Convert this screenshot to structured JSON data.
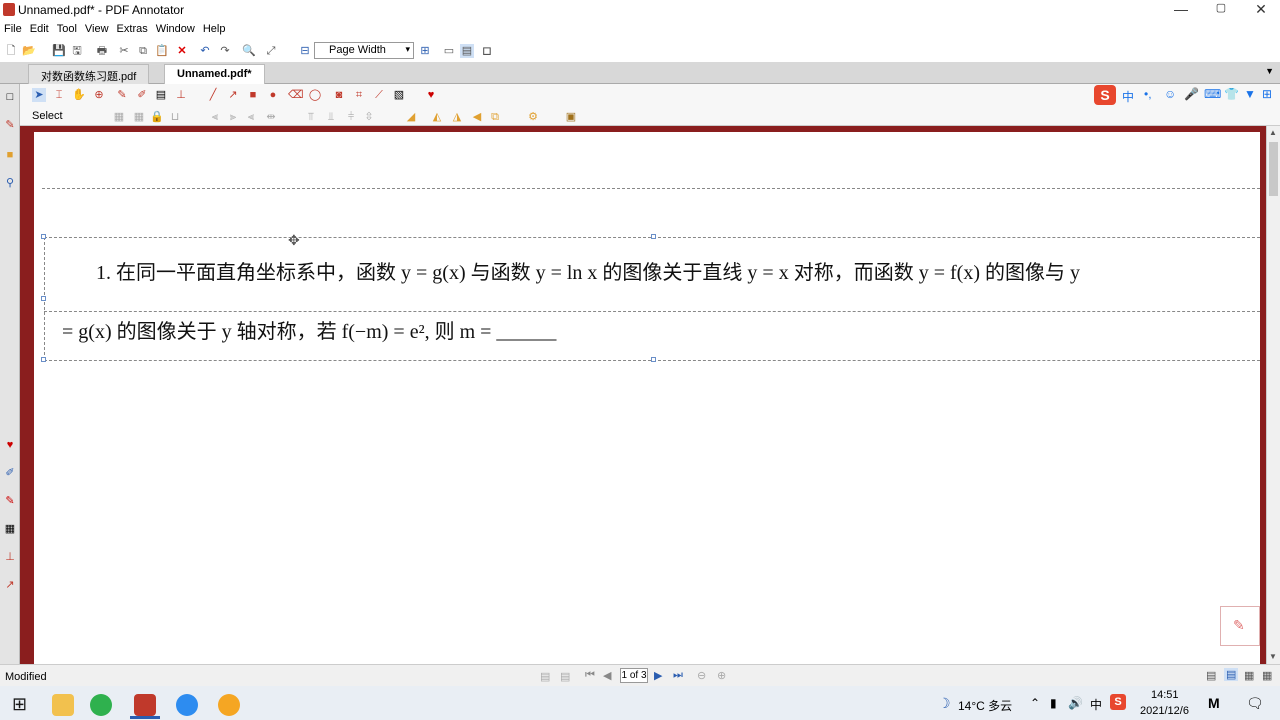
{
  "window": {
    "title": "Unnamed.pdf* - PDF Annotator"
  },
  "menu": [
    "File",
    "Edit",
    "Tool",
    "View",
    "Extras",
    "Window",
    "Help"
  ],
  "toolbar": {
    "zoom_label": "Page Width"
  },
  "tabs": [
    {
      "label": "对数函数练习题.pdf"
    },
    {
      "label": "Unnamed.pdf*"
    }
  ],
  "tool_status": {
    "label": "Select"
  },
  "document": {
    "line1": "1.  在同一平面直角坐标系中，函数 y = g(x) 与函数 y = ln x 的图像关于直线 y = x 对称，而函数 y = f(x) 的图像与 y",
    "line2": "= g(x) 的图像关于 y 轴对称，若 f(−m) = e², 则 m = ______"
  },
  "status": {
    "text": "Modified",
    "page_indicator": "1 of 3"
  },
  "tray": {
    "weather": "14°C  多云",
    "time": "14:51",
    "date": "2021/12/6",
    "ime": "中"
  },
  "colors": {
    "frame": "#8a1e1e",
    "ime_accent": "#1a73e8",
    "sogou": "#e8472e"
  }
}
